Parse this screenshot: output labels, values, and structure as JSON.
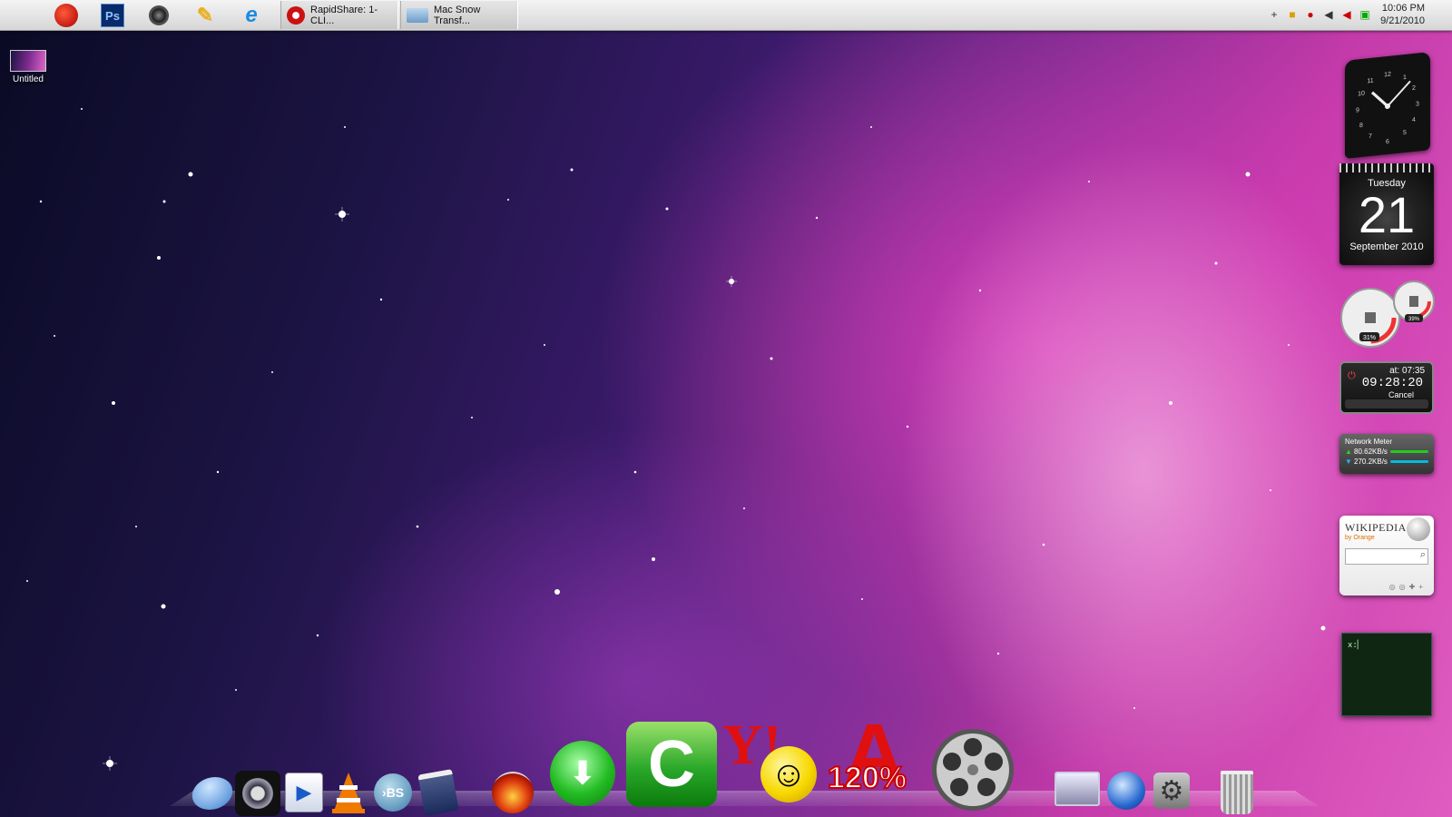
{
  "taskbar": {
    "tasks": [
      {
        "label": "RapidShare: 1-CLI...",
        "icon": "opera-icon",
        "color": "#cc1010"
      },
      {
        "label": "Mac Snow Transf...",
        "icon": "window-icon",
        "color": "#88aacc"
      }
    ],
    "clock": {
      "time": "10:06 PM",
      "date": "9/21/2010"
    }
  },
  "desktop": {
    "icons": [
      {
        "label": "Untitled"
      }
    ]
  },
  "gadgets": {
    "calendar": {
      "weekday": "Tuesday",
      "day": "21",
      "month_year": "September 2010"
    },
    "cpu_meter": {
      "cpu": "31%",
      "ram": "39%"
    },
    "shutdown_timer": {
      "at": "at: 07:35",
      "countdown": "09:28:20",
      "cancel_label": "Cancel"
    },
    "network_meter": {
      "title": "Network Meter",
      "upload": "80.62KB/s",
      "download": "270.2KB/s"
    },
    "wikipedia": {
      "title": "WIKIPEDIA",
      "subtitle": "by Orange",
      "search_value": ""
    },
    "terminal": {
      "prompt": "x:"
    }
  },
  "dock": {
    "zoom_label": "120%"
  },
  "colors": {
    "accent_pink": "#e05cc0",
    "deep_space": "#0a0a24",
    "taskbar": "#e0e0e0"
  }
}
